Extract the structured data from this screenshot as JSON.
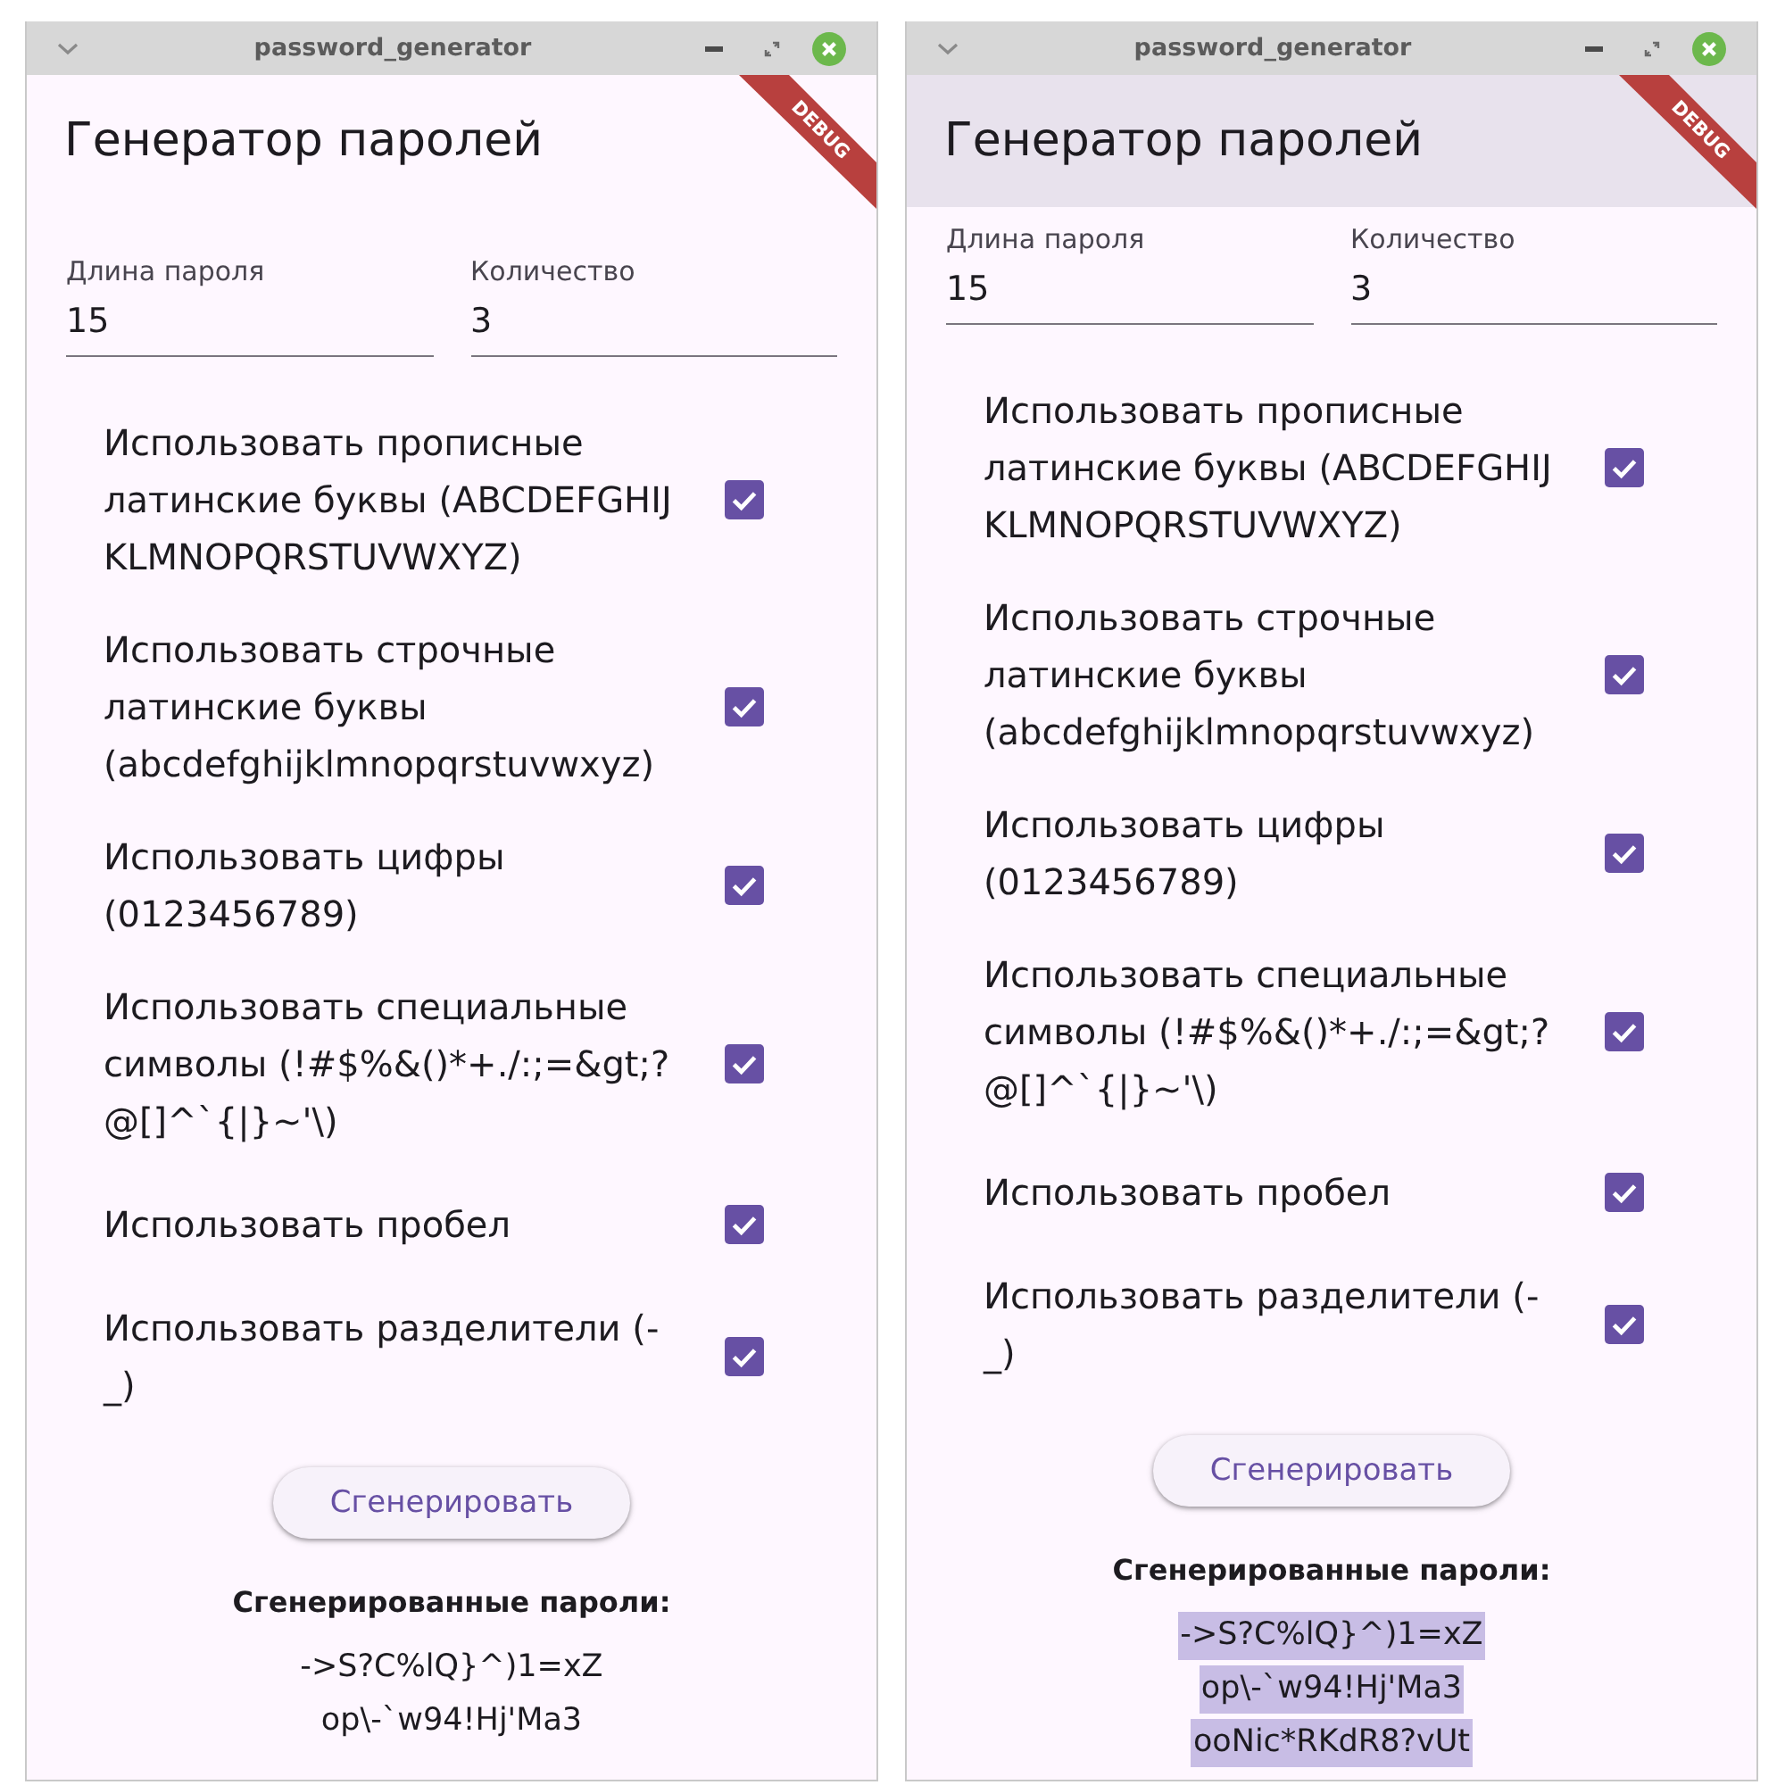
{
  "windows": [
    {
      "title": "password_generator",
      "app_bar": {
        "title": "Генератор паролей",
        "scrolled_under": false
      },
      "debug_banner": "DEBUG",
      "fields": [
        {
          "label": "Длина пароля",
          "value": "15"
        },
        {
          "label": "Количество",
          "value": "3"
        }
      ],
      "options": [
        {
          "label": "Использовать прописные латинские буквы (ABCDEFGHIJKLMNOPQRSTUVWXYZ)",
          "checked": true
        },
        {
          "label": "Использовать строчные латинские буквы (abcdefghijklmnopqrstuvwxyz)",
          "checked": true
        },
        {
          "label": "Использовать цифры (0123456789)",
          "checked": true
        },
        {
          "label": "Использовать специальные символы (!#$%&()*+./:;=&gt;?@[]^`{|}~'\\)",
          "checked": true
        },
        {
          "label": "Использовать пробел",
          "checked": true
        },
        {
          "label": "Использовать разделители (-_)",
          "checked": true
        }
      ],
      "generate_button": "Сгенерировать",
      "results": {
        "heading": "Сгенерированные пароли:",
        "highlighted": false,
        "passwords": [
          "->S?C%lQ}^)1=xZ",
          "op\\-`w94!Hj'Ma3"
        ]
      }
    },
    {
      "title": "password_generator",
      "app_bar": {
        "title": "Генератор паролей",
        "scrolled_under": true
      },
      "debug_banner": "DEBUG",
      "fields": [
        {
          "label": "Длина пароля",
          "value": "15"
        },
        {
          "label": "Количество",
          "value": "3"
        }
      ],
      "options": [
        {
          "label": "Использовать прописные латинские буквы (ABCDEFGHIJKLMNOPQRSTUVWXYZ)",
          "checked": true
        },
        {
          "label": "Использовать строчные латинские буквы (abcdefghijklmnopqrstuvwxyz)",
          "checked": true
        },
        {
          "label": "Использовать цифры (0123456789)",
          "checked": true
        },
        {
          "label": "Использовать специальные символы (!#$%&()*+./:;=&gt;?@[]^`{|}~'\\)",
          "checked": true
        },
        {
          "label": "Использовать пробел",
          "checked": true
        },
        {
          "label": "Использовать разделители (-_)",
          "checked": true
        }
      ],
      "generate_button": "Сгенерировать",
      "results": {
        "heading": "Сгенерированные пароли:",
        "highlighted": true,
        "passwords": [
          "->S?C%lQ}^)1=xZ",
          "op\\-`w94!Hj'Ma3",
          "ooNic*RKdR8?vUt"
        ]
      }
    }
  ]
}
